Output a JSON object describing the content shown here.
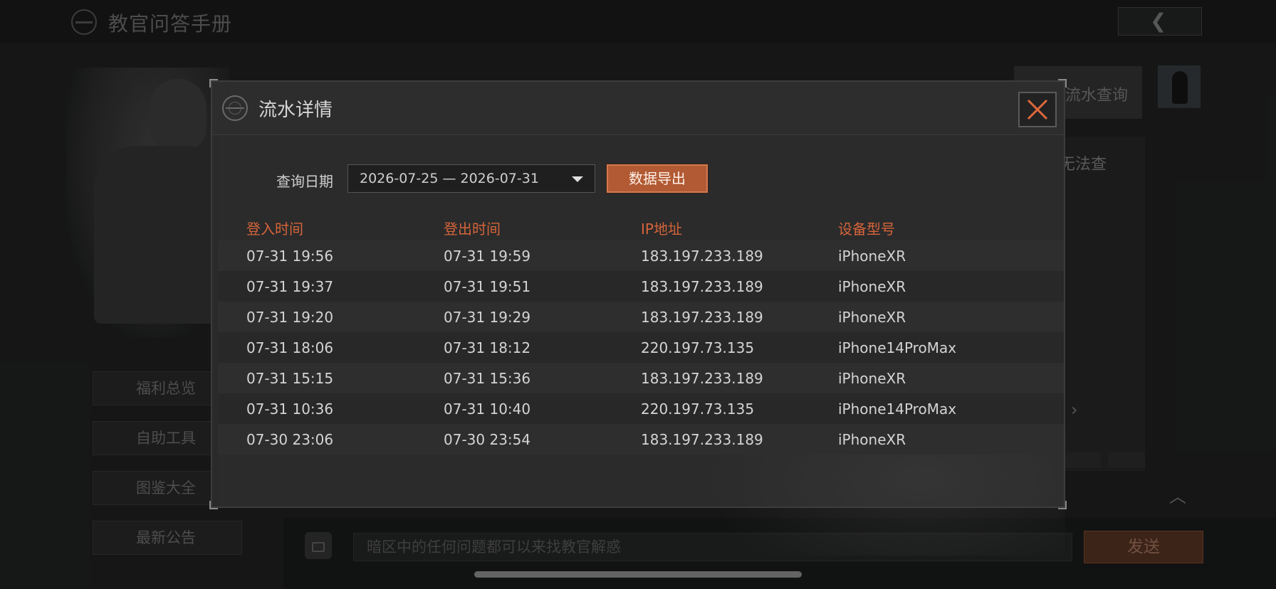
{
  "header": {
    "title": "教官问答手册",
    "back_icon": "❮"
  },
  "side_menu": [
    {
      "label": "福利总览"
    },
    {
      "label": "自助工具"
    },
    {
      "label": "图鉴大全"
    },
    {
      "label": "最新公告"
    }
  ],
  "right_panel": {
    "tab_label": "流水查询",
    "partial_text": "无法查",
    "arrow": "›"
  },
  "chat": {
    "placeholder": "暗区中的任何问题都可以来找教官解惑",
    "send_label": "发送"
  },
  "modal": {
    "title": "流水详情",
    "date_label": "查询日期",
    "date_range": "2026-07-25 — 2026-07-31",
    "export_label": "数据导出",
    "columns": [
      "登入时间",
      "登出时间",
      "IP地址",
      "设备型号"
    ],
    "rows": [
      [
        "07-31 19:56",
        "07-31 19:59",
        "183.197.233.189",
        "iPhoneXR"
      ],
      [
        "07-31 19:37",
        "07-31 19:51",
        "183.197.233.189",
        "iPhoneXR"
      ],
      [
        "07-31 19:20",
        "07-31 19:29",
        "183.197.233.189",
        "iPhoneXR"
      ],
      [
        "07-31 18:06",
        "07-31 18:12",
        "220.197.73.135",
        "iPhone14ProMax"
      ],
      [
        "07-31 15:15",
        "07-31 15:36",
        "183.197.233.189",
        "iPhoneXR"
      ],
      [
        "07-31 10:36",
        "07-31 10:40",
        "220.197.73.135",
        "iPhone14ProMax"
      ],
      [
        "07-30 23:06",
        "07-30 23:54",
        "183.197.233.189",
        "iPhoneXR"
      ]
    ]
  },
  "colors": {
    "accent": "#d5643a",
    "export_button": "#b15a34",
    "send_button": "#4a2c1e"
  }
}
